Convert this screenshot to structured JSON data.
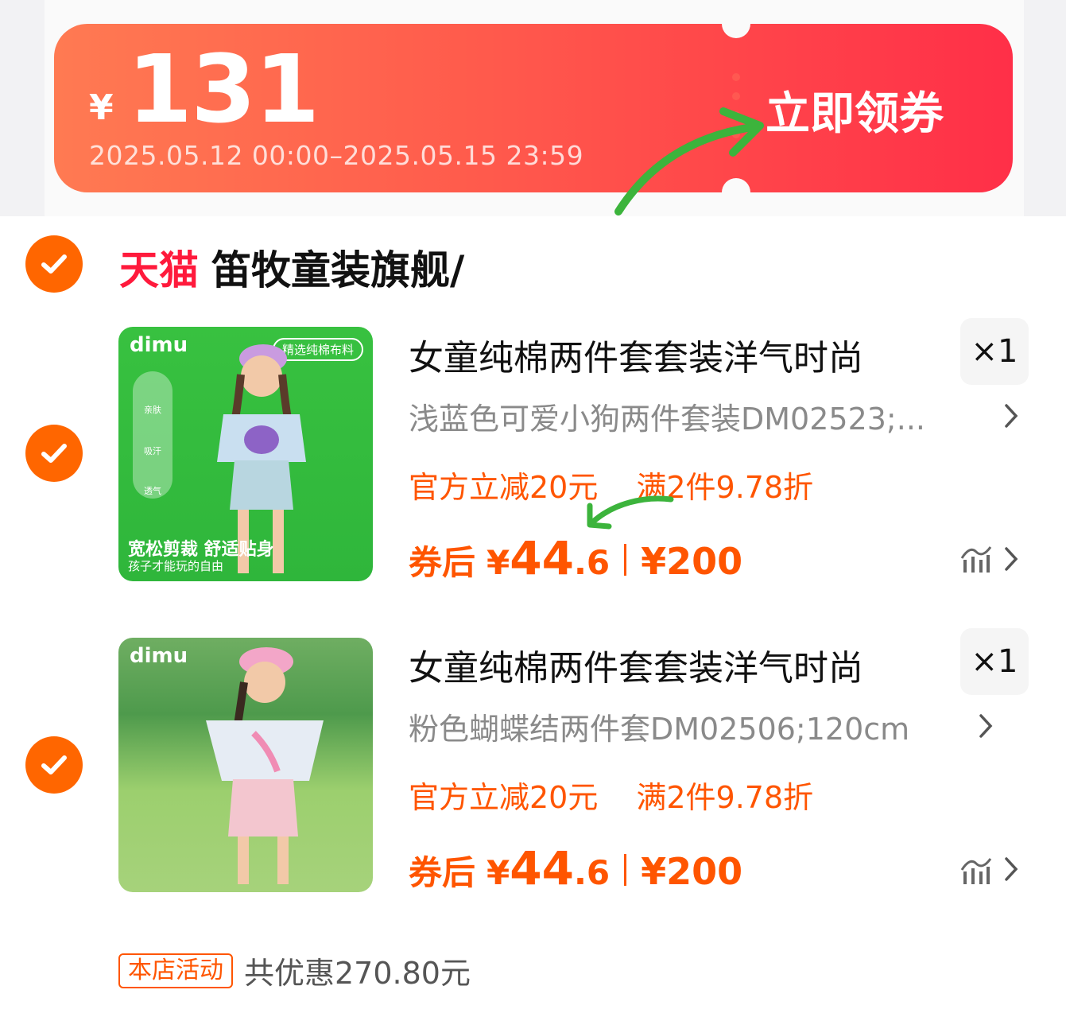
{
  "coupon": {
    "currency": "¥",
    "amount": "131",
    "period": "2025.05.12 00:00–2025.05.15 23:59",
    "claim_label": "立即领券"
  },
  "store": {
    "platform": "天猫",
    "name": "笛牧童装旗舰/"
  },
  "items": [
    {
      "thumb": {
        "brand": "dimu",
        "badge": "精选纯棉布料",
        "features": [
          "亲肤",
          "吸汗",
          "透气"
        ],
        "slogan": "宽松剪裁 舒适贴身",
        "subslogan": "孩子才能玩的自由"
      },
      "title": "女童纯棉两件套套装洋气时尚",
      "qty": "×1",
      "sku": "浅蓝色可爱小狗两件套装DM02523;...",
      "promo1": "官方立减20元",
      "promo2": "满2件9.78折",
      "price_label": "券后",
      "price_currency": "¥",
      "price_int": "44",
      "price_dec": ".6",
      "orig_price": "¥200"
    },
    {
      "thumb": {
        "brand": "dimu"
      },
      "title": "女童纯棉两件套套装洋气时尚",
      "qty": "×1",
      "sku": "粉色蝴蝶结两件套DM02506;120cm",
      "promo1": "官方立减20元",
      "promo2": "满2件9.78折",
      "price_label": "券后",
      "price_currency": "¥",
      "price_int": "44",
      "price_dec": ".6",
      "orig_price": "¥200"
    }
  ],
  "activity": {
    "tag": "本店活动",
    "text": "共优惠270.80元"
  },
  "colors": {
    "accent": "#ff5500",
    "check": "#ff6600",
    "tmall": "#ff1a3c",
    "coupon_start": "#ff7a52",
    "coupon_end": "#ff2f48",
    "annotation_arrow": "#3cb43c"
  },
  "icons": [
    "check-icon",
    "chevron-right-icon",
    "price-trend-icon",
    "annotation-arrow-icon"
  ]
}
